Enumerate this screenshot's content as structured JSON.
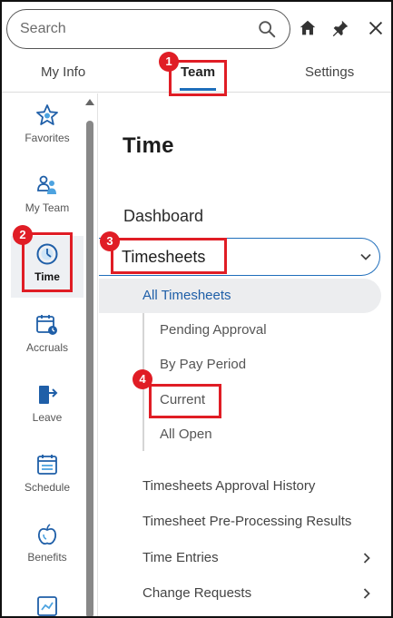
{
  "search": {
    "placeholder": "Search"
  },
  "tabs": [
    {
      "label": "My Info"
    },
    {
      "label": "Team",
      "active": true
    },
    {
      "label": "Settings"
    }
  ],
  "sidebar": {
    "items": [
      {
        "label": "Favorites",
        "icon": "star-icon"
      },
      {
        "label": "My Team",
        "icon": "team-icon"
      },
      {
        "label": "Time",
        "icon": "clock-icon",
        "active": true
      },
      {
        "label": "Accruals",
        "icon": "calendar-clock-icon"
      },
      {
        "label": "Leave",
        "icon": "exit-door-icon"
      },
      {
        "label": "Schedule",
        "icon": "schedule-icon"
      },
      {
        "label": "Benefits",
        "icon": "apple-icon"
      }
    ]
  },
  "main": {
    "title": "Time",
    "dashboard": "Dashboard",
    "timesheets": "Timesheets",
    "all_timesheets": "All Timesheets",
    "sub_items": [
      "Pending Approval",
      "By Pay Period",
      "Current",
      "All Open"
    ],
    "nav_items": [
      "Timesheets Approval History",
      "Timesheet Pre-Processing Results",
      "Time Entries",
      "Change Requests"
    ]
  },
  "annotations": [
    "1",
    "2",
    "3",
    "4"
  ],
  "colors": {
    "accent": "#1f6ebb",
    "highlight": "#e01d25",
    "active_bg": "#eef0f3"
  }
}
